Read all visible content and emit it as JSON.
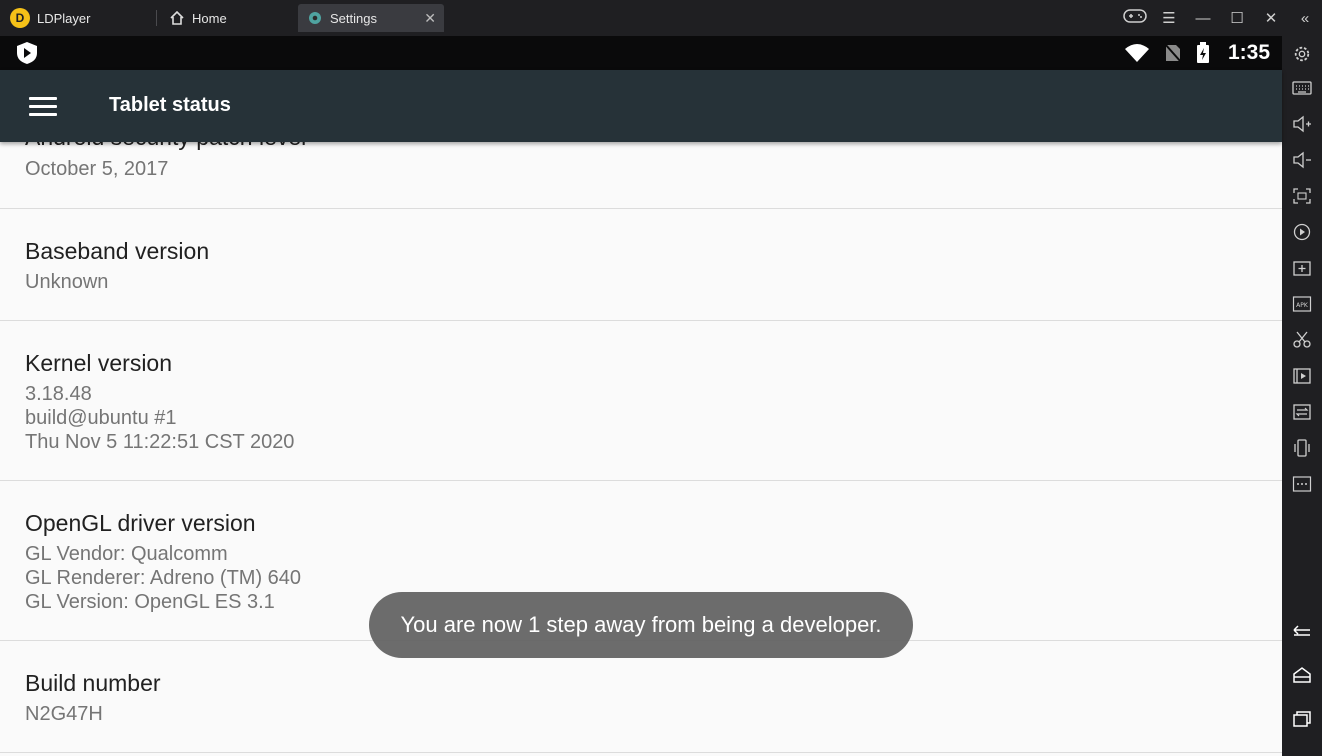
{
  "window": {
    "app_name": "LDPlayer",
    "tabs": [
      {
        "label": "Home"
      },
      {
        "label": "Settings"
      }
    ]
  },
  "statusbar": {
    "time": "1:35"
  },
  "toolbar": {
    "title": "Tablet status"
  },
  "items": [
    {
      "title": "Android security patch level",
      "lines": [
        "October 5, 2017"
      ]
    },
    {
      "title": "Baseband version",
      "lines": [
        "Unknown"
      ]
    },
    {
      "title": "Kernel version",
      "lines": [
        "3.18.48",
        "build@ubuntu #1",
        "Thu Nov 5 11:22:51 CST 2020"
      ]
    },
    {
      "title": "OpenGL driver version",
      "lines": [
        "GL Vendor: Qualcomm",
        "GL Renderer: Adreno (TM) 640",
        "GL Version: OpenGL ES 3.1"
      ]
    },
    {
      "title": "Build number",
      "lines": [
        "N2G47H"
      ]
    }
  ],
  "toast": {
    "message": "You are now 1 step away from being a developer."
  },
  "sidebar_icons": [
    "settings-gear-icon",
    "keyboard-icon",
    "volume-up-icon",
    "volume-down-icon",
    "fullscreen-icon",
    "record-icon",
    "add-app-icon",
    "apk-icon",
    "scissors-icon",
    "video-icon",
    "sync-icon",
    "shake-icon",
    "more-icon",
    "back-icon",
    "home-icon",
    "recents-icon"
  ]
}
